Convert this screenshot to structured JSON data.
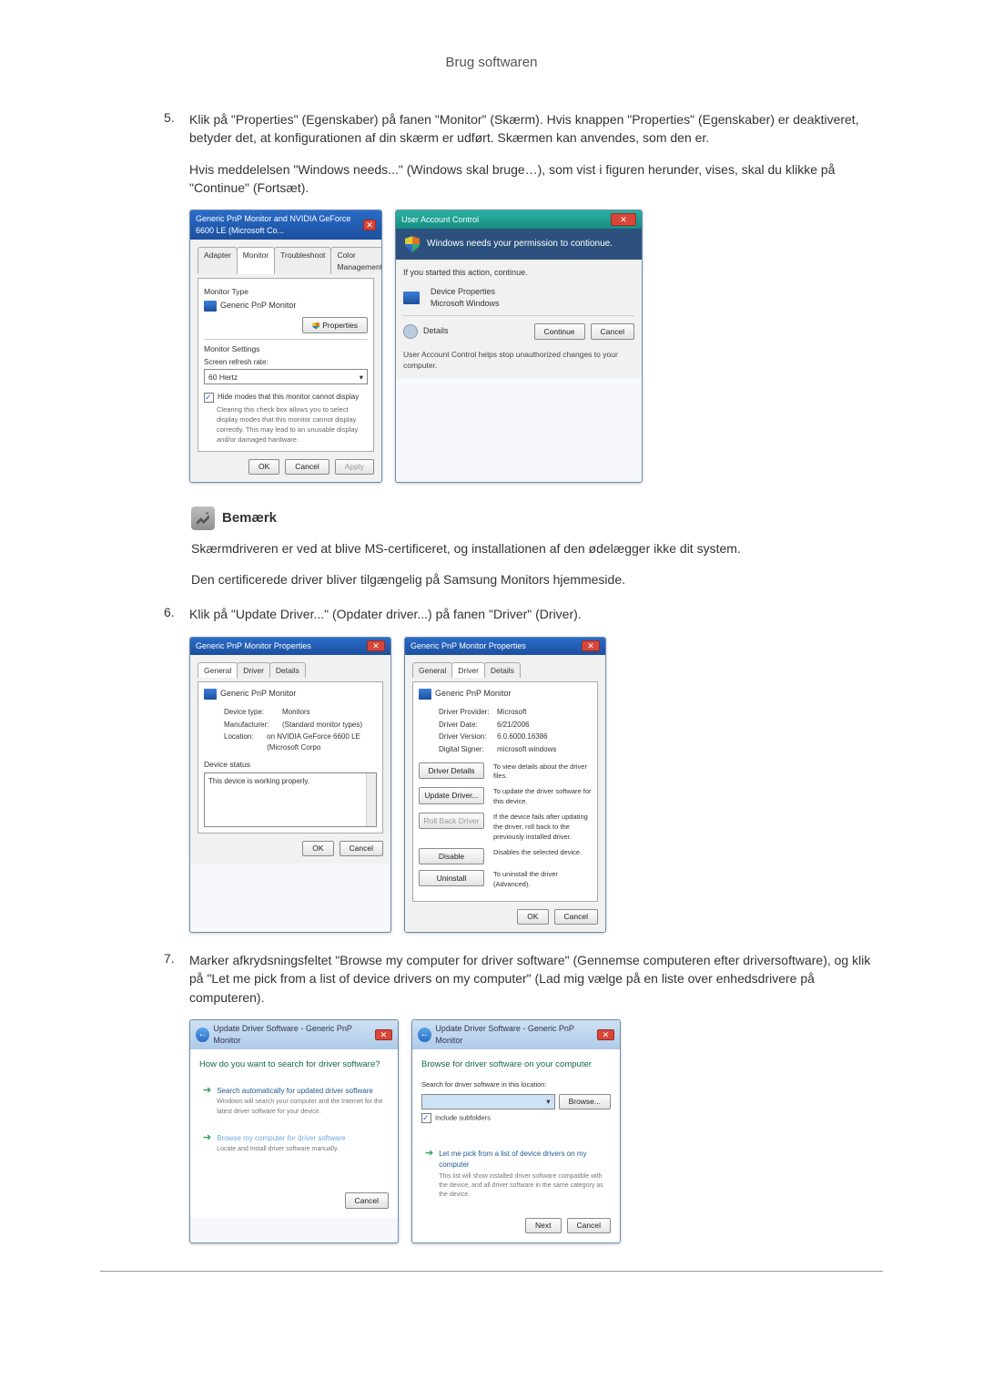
{
  "pageTitle": "Brug softwaren",
  "steps": {
    "s5": {
      "num": "5.",
      "p1": "Klik på \"Properties\" (Egenskaber) på fanen \"Monitor\" (Skærm). Hvis knappen \"Properties\" (Egenskaber) er deaktiveret, betyder det, at konfigurationen af din skærm er udført. Skærmen kan anvendes, som den er.",
      "p2": "Hvis meddelelsen \"Windows needs...\" (Windows skal bruge…), som vist i figuren herunder, vises, skal du klikke på \"Continue\" (Fortsæt)."
    },
    "s6": {
      "num": "6.",
      "p1": "Klik på \"Update Driver...\" (Opdater driver...) på fanen \"Driver\" (Driver)."
    },
    "s7": {
      "num": "7.",
      "p1": "Marker afkrydsningsfeltet \"Browse my computer for driver software\" (Gennemse computeren efter driversoftware), og klik på \"Let me pick from a list of device drivers on my computer\" (Lad mig vælge på en liste over enhedsdrivere på computeren)."
    }
  },
  "note": {
    "title": "Bemærk",
    "p1": "Skærmdriveren er ved at blive MS-certificeret, og installationen af den ødelægger ikke dit system.",
    "p2": "Den certificerede driver bliver tilgængelig på Samsung Monitors hjemmeside."
  },
  "fig1": {
    "winTitle": "Generic PnP Monitor and NVIDIA GeForce 6600 LE (Microsoft Co...",
    "tabs": [
      "Adapter",
      "Monitor",
      "Troubleshoot",
      "Color Management"
    ],
    "activeTab": "Monitor",
    "monitorTypeLabel": "Monitor Type",
    "monitorTypeValue": "Generic PnP Monitor",
    "propertiesBtn": "Properties",
    "monitorSettingsLabel": "Monitor Settings",
    "refreshLabel": "Screen refresh rate:",
    "refreshValue": "60 Hertz",
    "hideModes": "Hide modes that this monitor cannot display",
    "hideModesDesc": "Clearing this check box allows you to select display modes that this monitor cannot display correctly. This may lead to an unusable display and/or damaged hardware.",
    "ok": "OK",
    "cancel": "Cancel",
    "apply": "Apply"
  },
  "fig2": {
    "winTitle": "User Account Control",
    "banner": "Windows needs your permission to contionue.",
    "ifYouStarted": "If you started this action, continue.",
    "prog": "Device Properties",
    "pub": "Microsoft Windows",
    "details": "Details",
    "continue": "Continue",
    "cancel": "Cancel",
    "footer": "User Account Control helps stop unauthorized changes to your computer."
  },
  "fig3": {
    "winTitle": "Generic PnP Monitor Properties",
    "tabs": [
      "General",
      "Driver",
      "Details"
    ],
    "deviceName": "Generic PnP Monitor",
    "rows": {
      "deviceTypeK": "Device type:",
      "deviceTypeV": "Monitors",
      "manufacturerK": "Manufacturer:",
      "manufacturerV": "(Standard monitor types)",
      "locationK": "Location:",
      "locationV": "on NVIDIA GeForce 6600 LE (Microsoft Corpo"
    },
    "deviceStatusLabel": "Device status",
    "deviceStatusText": "This device is working properly.",
    "ok": "OK",
    "cancel": "Cancel"
  },
  "fig4": {
    "winTitle": "Generic PnP Monitor Properties",
    "tabs": [
      "General",
      "Driver",
      "Details"
    ],
    "deviceName": "Generic PnP Monitor",
    "rows": {
      "providerK": "Driver Provider:",
      "providerV": "Microsoft",
      "dateK": "Driver Date:",
      "dateV": "6/21/2006",
      "versionK": "Driver Version:",
      "versionV": "6.0.6000.16386",
      "signerK": "Digital Signer:",
      "signerV": "microsoft windows"
    },
    "btns": {
      "details": "Driver Details",
      "detailsDesc": "To view details about the driver files.",
      "update": "Update Driver...",
      "updateDesc": "To update the driver software for this device.",
      "rollback": "Roll Back Driver",
      "rollbackDesc": "If the device fails after updating the driver, roll back to the previously installed driver.",
      "disable": "Disable",
      "disableDesc": "Disables the selected device.",
      "uninstall": "Uninstall",
      "uninstallDesc": "To uninstall the driver (Advanced)."
    },
    "ok": "OK",
    "cancel": "Cancel"
  },
  "fig5": {
    "breadcrumb": "Update Driver Software - Generic PnP Monitor",
    "heading": "How do you want to search for driver software?",
    "opt1": "Search automatically for updated driver software",
    "opt1sub": "Windows will search your computer and the Internet for the latest driver software for your device.",
    "opt2": "Browse my computer for driver software",
    "opt2sub": "Locate and install driver software manually.",
    "cancel": "Cancel"
  },
  "fig6": {
    "breadcrumb": "Update Driver Software - Generic PnP Monitor",
    "heading": "Browse for driver software on your computer",
    "searchLabel": "Search for driver software in this location:",
    "browse": "Browse...",
    "include": "Include subfolders",
    "opt": "Let me pick from a list of device drivers on my computer",
    "optsub": "This list will show installed driver software compatible with the device, and all driver software in the same category as the device.",
    "next": "Next",
    "cancel": "Cancel"
  }
}
